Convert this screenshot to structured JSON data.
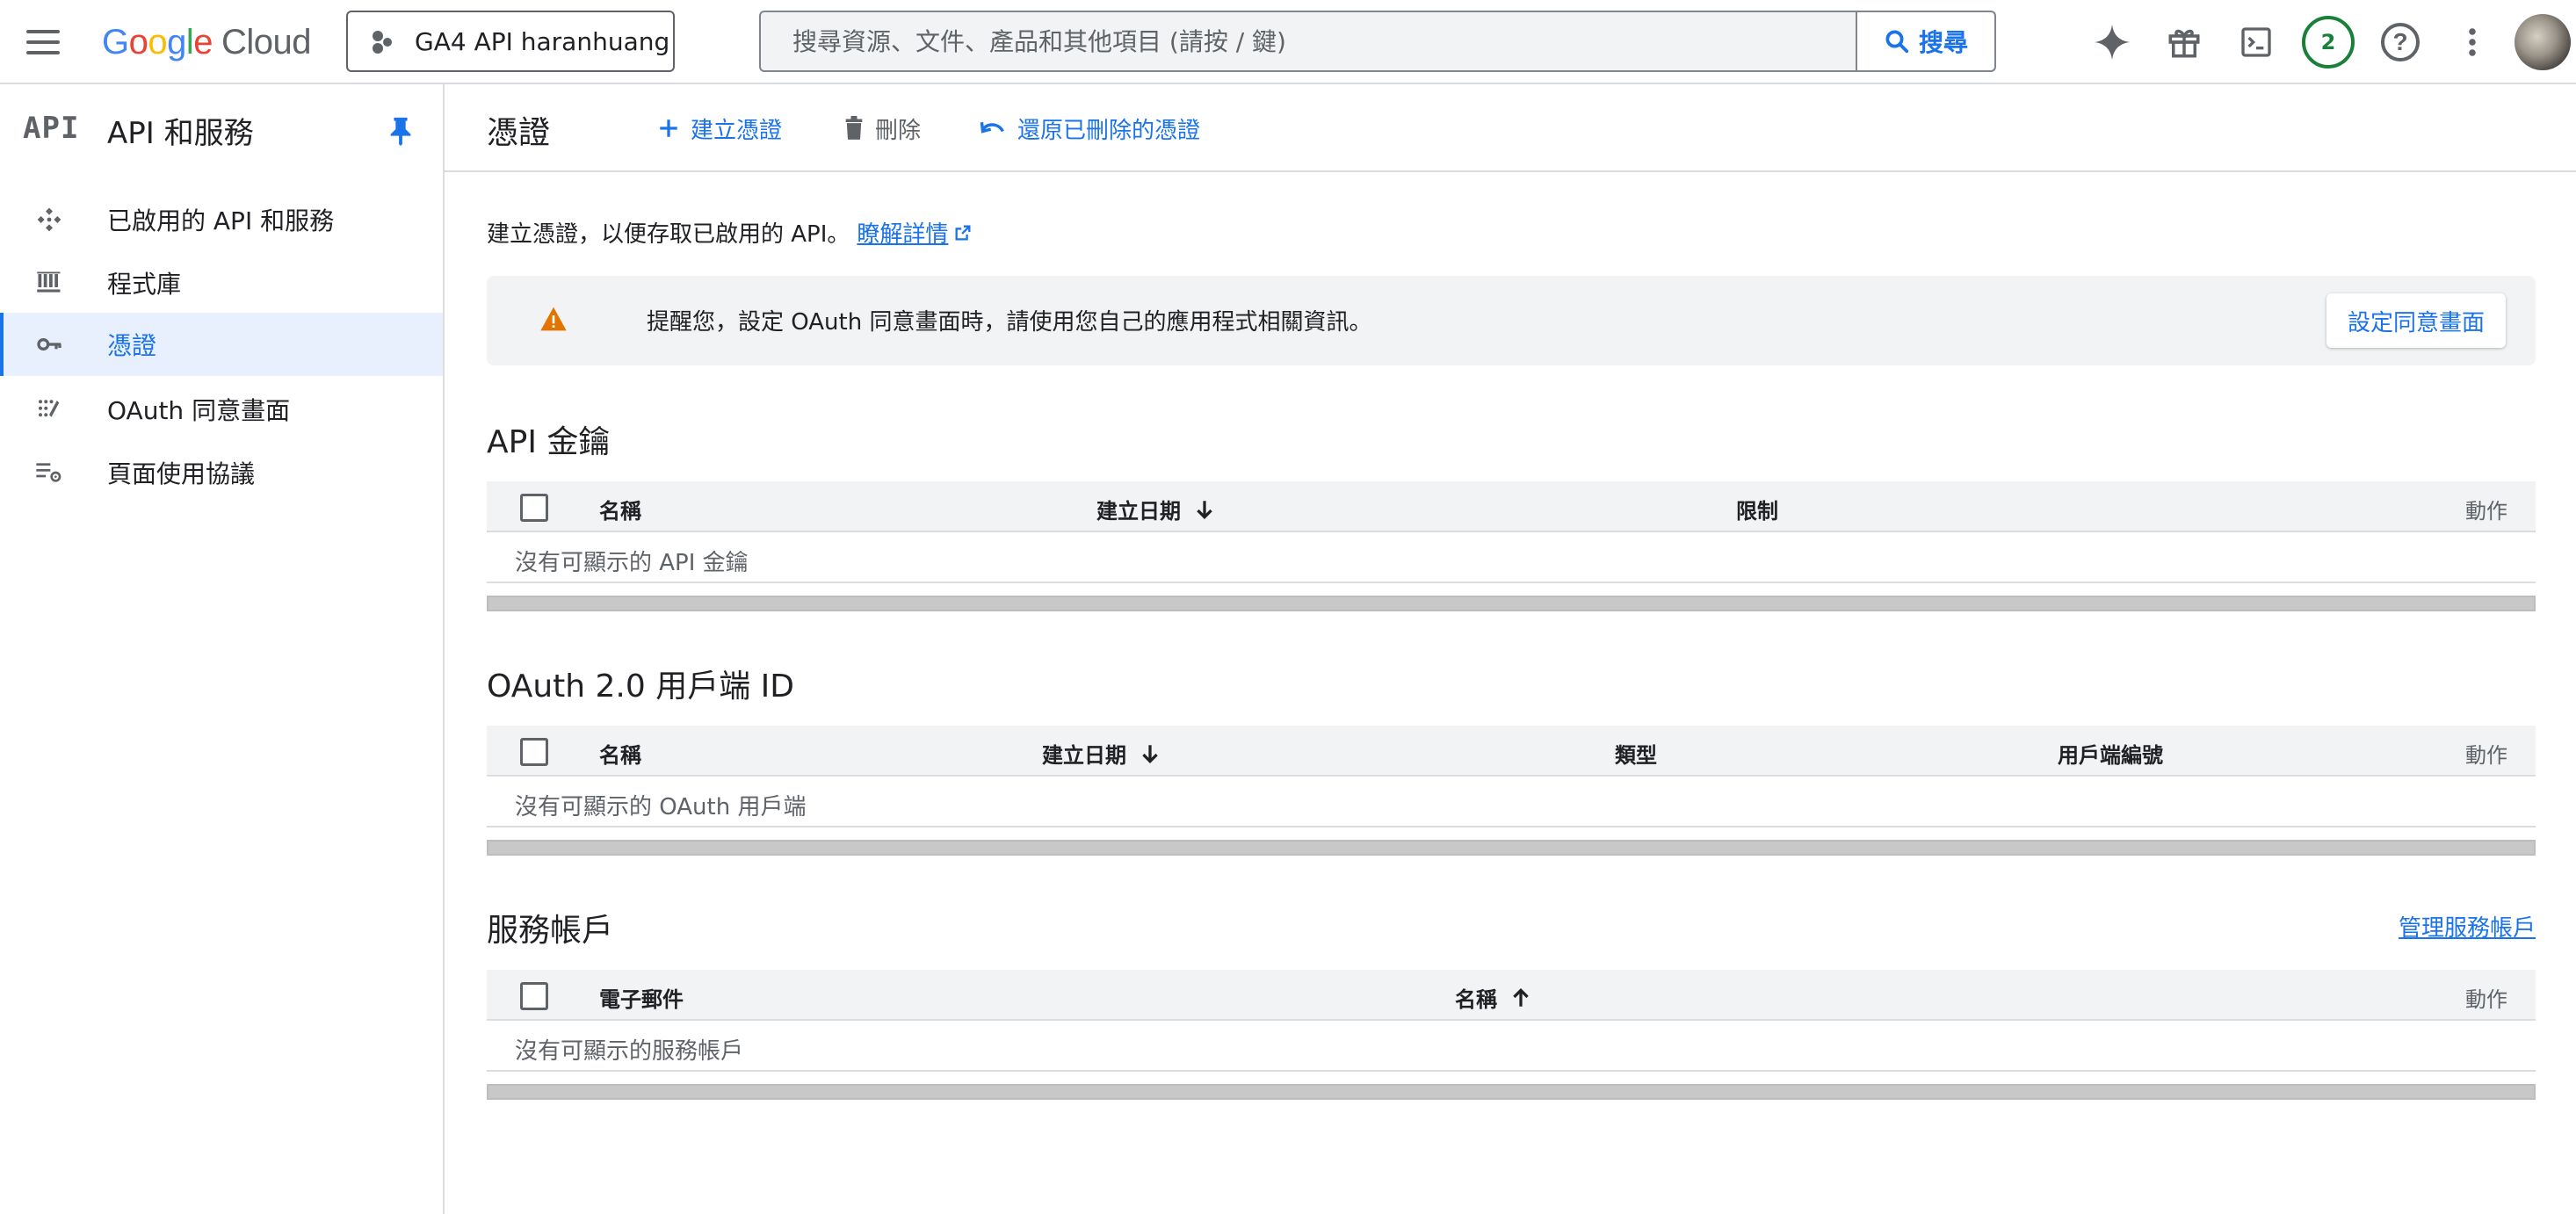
{
  "topbar": {
    "logo_google": [
      "G",
      "o",
      "o",
      "g",
      "l",
      "e"
    ],
    "logo_cloud": "Cloud",
    "project": "GA4 API haranhuang",
    "search_placeholder": "搜尋資源、文件、產品和其他項目 (請按 / 鍵)",
    "search_button": "搜尋",
    "notifications_count": "2",
    "help_glyph": "?",
    "icons": [
      "menu-icon",
      "gemini-sparkle-icon",
      "gift-icon",
      "cloud-shell-icon",
      "help-icon",
      "more-vert-icon"
    ]
  },
  "sidebar": {
    "mark": "API",
    "title": "API 和服務",
    "items": [
      {
        "label": "已啟用的 API 和服務",
        "icon": "api-hub-icon"
      },
      {
        "label": "程式庫",
        "icon": "library-icon"
      },
      {
        "label": "憑證",
        "icon": "key-icon",
        "active": true
      },
      {
        "label": "OAuth 同意畫面",
        "icon": "oauth-dots-icon"
      },
      {
        "label": "頁面使用協議",
        "icon": "settings-list-icon"
      }
    ]
  },
  "main": {
    "title": "憑證",
    "actions": {
      "create": "建立憑證",
      "delete": "刪除",
      "restore": "還原已刪除的憑證"
    },
    "intro": "建立憑證，以便存取已啟用的 API。",
    "learn_more": "瞭解詳情",
    "notice": {
      "message": "提醒您，設定 OAuth 同意畫面時，請使用您自己的應用程式相關資訊。",
      "button": "設定同意畫面"
    },
    "api_keys": {
      "title": "API 金鑰",
      "columns": [
        "名稱",
        "建立日期",
        "限制",
        "動作"
      ],
      "empty": "沒有可顯示的 API 金鑰"
    },
    "oauth": {
      "title": "OAuth 2.0 用戶端 ID",
      "columns": [
        "名稱",
        "建立日期",
        "類型",
        "用戶端編號",
        "動作"
      ],
      "empty": "沒有可顯示的 OAuth 用戶端"
    },
    "service_accounts": {
      "title": "服務帳戶",
      "manage": "管理服務帳戶",
      "columns": [
        "電子郵件",
        "名稱",
        "動作"
      ],
      "empty": "沒有可顯示的服務帳戶"
    }
  },
  "colors": {
    "accent": "#1a73e8",
    "warning": "#e37400",
    "badge": "#188038",
    "header_bg": "#f1f3f4"
  }
}
